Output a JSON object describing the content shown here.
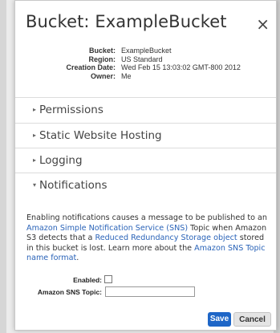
{
  "dialog": {
    "title": "Bucket: ExampleBucket",
    "close_icon": "×"
  },
  "meta": {
    "items": [
      {
        "label": "Bucket:",
        "value": "ExampleBucket"
      },
      {
        "label": "Region:",
        "value": "US Standard"
      },
      {
        "label": "Creation Date:",
        "value": "Wed Feb 15 13:03:02 GMT-800 2012"
      },
      {
        "label": "Owner:",
        "value": "Me"
      }
    ]
  },
  "sections": [
    {
      "label": "Permissions",
      "arrow": "▸",
      "expanded": false
    },
    {
      "label": "Static Website Hosting",
      "arrow": "▸",
      "expanded": false
    },
    {
      "label": "Logging",
      "arrow": "▸",
      "expanded": false
    },
    {
      "label": "Notifications",
      "arrow": "▾",
      "expanded": true
    }
  ],
  "notifications": {
    "text1": "Enabling notifications causes a message to be published to an ",
    "link_sns": "Amazon Simple Notification Service (SNS)",
    "text2": " Topic when Amazon S3 detects that a ",
    "link_rrs": "Reduced Redundancy Storage object",
    "text3": " stored in this bucket is lost. Learn more about the ",
    "link_format": "Amazon SNS Topic name format",
    "text4": ".",
    "enabled_label": "Enabled:",
    "topic_label": "Amazon SNS Topic:",
    "topic_value": ""
  },
  "buttons": {
    "save": "Save",
    "cancel": "Cancel"
  },
  "colors": {
    "link": "#2a63b8",
    "save_button": "#1e66c7"
  }
}
